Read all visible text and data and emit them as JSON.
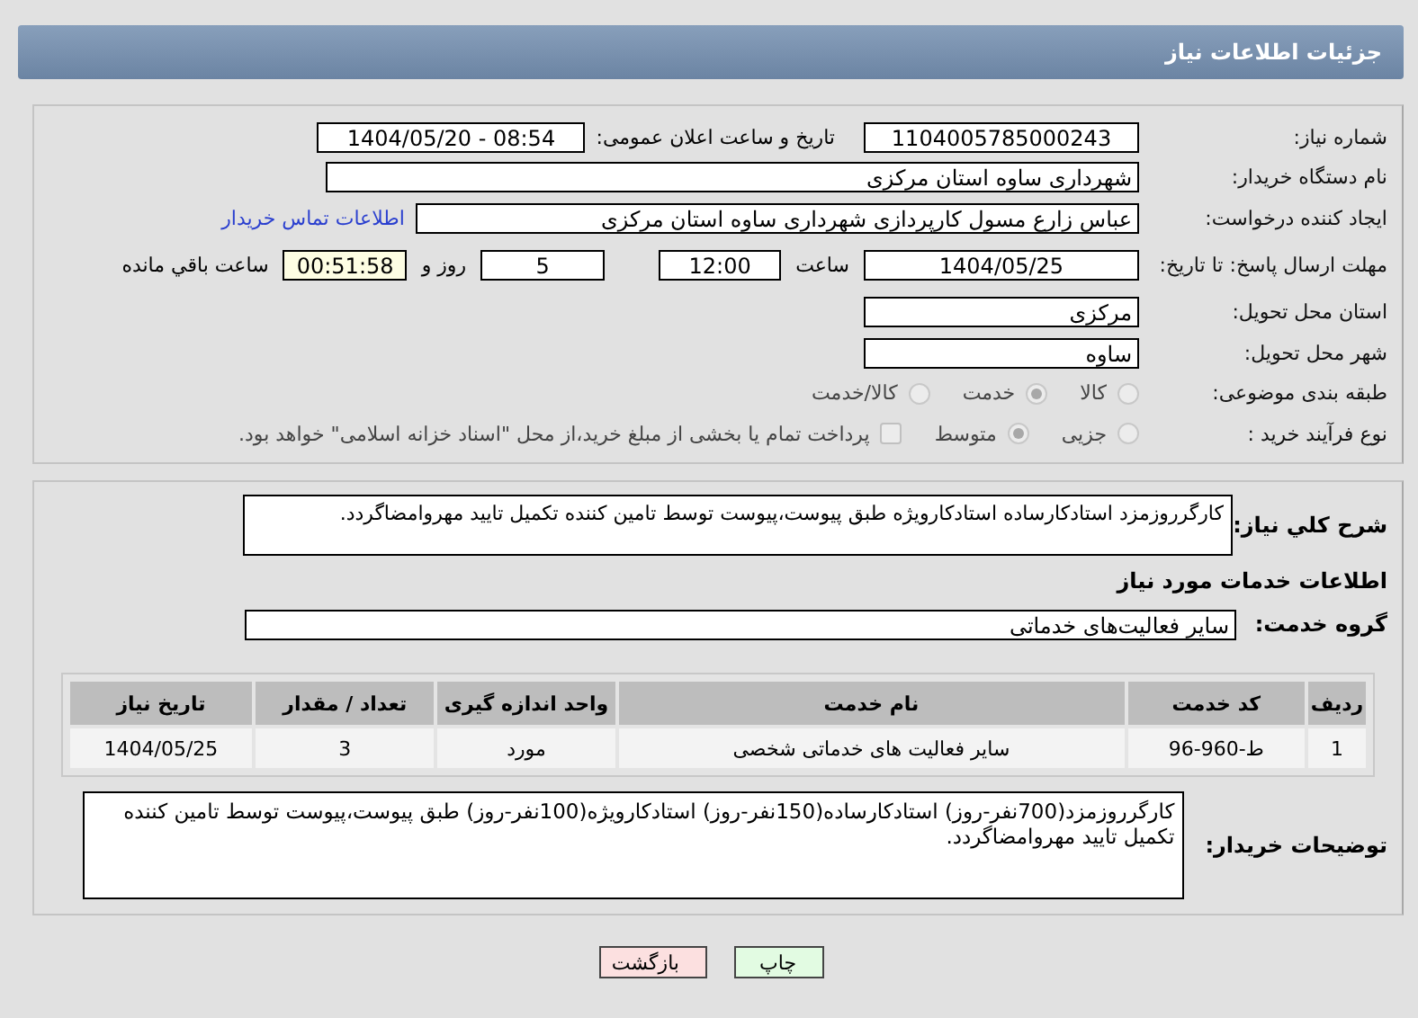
{
  "header": {
    "title": "جزئیات اطلاعات نیاز"
  },
  "general": {
    "need_number": {
      "label": "شماره نیاز:",
      "value": "1104005785000243"
    },
    "announce": {
      "label": "تاریخ و ساعت اعلان عمومی:",
      "value": "1404/05/20 - 08:54"
    },
    "buyer": {
      "label": "نام دستگاه خریدار:",
      "value": "شهرداری ساوه استان مرکزی"
    },
    "creator": {
      "label": "ایجاد کننده درخواست:",
      "value": "عباس زارع مسول کارپردازی شهرداری ساوه استان مرکزی",
      "link": "اطلاعات تماس خریدار"
    },
    "deadline": {
      "label": "مهلت ارسال پاسخ: تا تاریخ:",
      "date": "1404/05/25",
      "time_label": "ساعت",
      "time": "12:00",
      "days": "5",
      "days_label": "روز و",
      "remaining": "00:51:58",
      "remaining_label": "ساعت باقي مانده"
    },
    "province": {
      "label": "استان محل تحویل:",
      "value": "مرکزی"
    },
    "city": {
      "label": "شهر محل تحویل:",
      "value": "ساوه"
    },
    "category": {
      "label": "طبقه بندی موضوعی:",
      "options": [
        {
          "label": "کالا",
          "selected": false
        },
        {
          "label": "خدمت",
          "selected": true
        },
        {
          "label": "کالا/خدمت",
          "selected": false
        }
      ]
    },
    "process": {
      "label": "نوع فرآیند خرید :",
      "options": [
        {
          "label": "جزیی",
          "selected": false
        },
        {
          "label": "متوسط",
          "selected": true
        }
      ],
      "payment": {
        "label": "پرداخت تمام یا بخشی از مبلغ خرید،از محل \"اسناد خزانه اسلامی\" خواهد بود.",
        "checked": false
      }
    }
  },
  "services": {
    "summary": {
      "label": "شرح کلي نیاز:",
      "value": "کارگرروزمزد استادکارساده استادکارویژه طبق پیوست،پیوست توسط تامین کننده تکمیل تایید مهروامضاگردد."
    },
    "heading": "اطلاعات خدمات مورد نیاز",
    "group": {
      "label": "گروه خدمت:",
      "value": "سایر فعالیت‌های خدماتی"
    },
    "table": {
      "columns": [
        "ردیف",
        "کد خدمت",
        "نام خدمت",
        "واحد اندازه گیری",
        "تعداد / مقدار",
        "تاریخ نیاز"
      ],
      "rows": [
        [
          "1",
          "ط-960-96",
          "سایر فعالیت های خدماتی شخصی",
          "مورد",
          "3",
          "1404/05/25"
        ]
      ]
    },
    "buyer_notes": {
      "label": "توضیحات خریدار:",
      "value": "کارگرروزمزد(700نفر-روز) استادکارساده(150نفر-روز) استادکارویژه(100نفر-روز) طبق پیوست،پیوست توسط تامین کننده تکمیل تایید مهروامضاگردد."
    }
  },
  "buttons": [
    {
      "label": "چاپ",
      "kind": "print"
    },
    {
      "label": "بازگشت",
      "kind": "back"
    }
  ]
}
